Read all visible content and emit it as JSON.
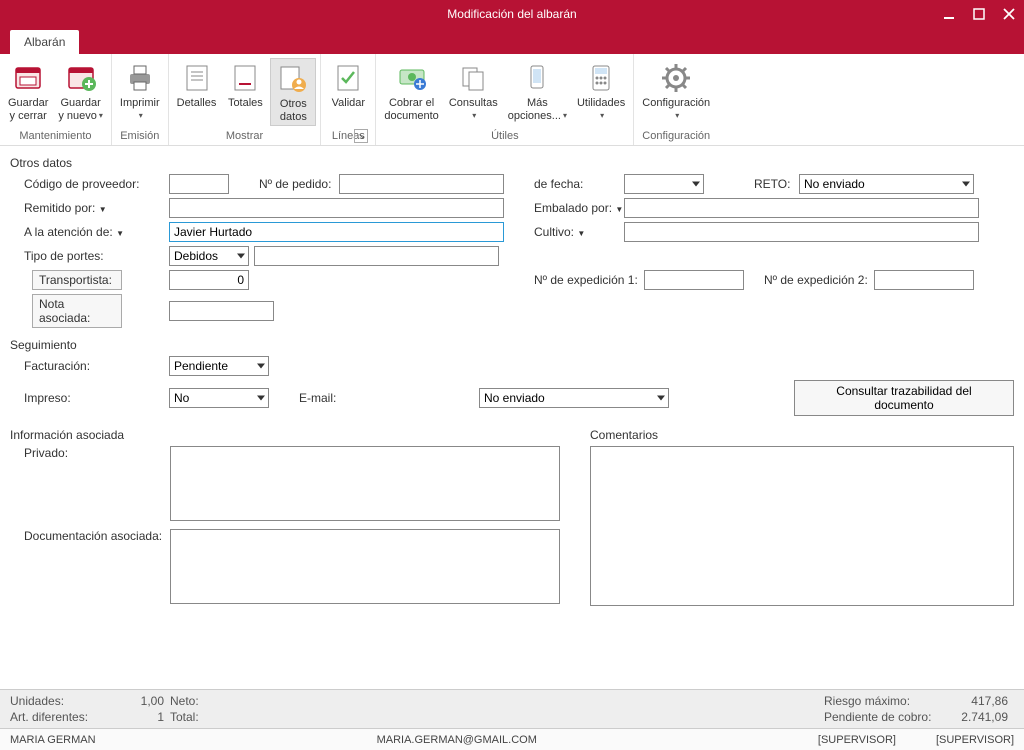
{
  "window": {
    "title": "Modificación del albarán"
  },
  "tabs": {
    "main": "Albarán"
  },
  "ribbon": {
    "mantenimiento": {
      "label": "Mantenimiento",
      "guardar_cerrar": "Guardar\ny cerrar",
      "guardar_nuevo": "Guardar\ny nuevo"
    },
    "emision": {
      "label": "Emisión",
      "imprimir": "Imprimir"
    },
    "mostrar": {
      "label": "Mostrar",
      "detalles": "Detalles",
      "totales": "Totales",
      "otros": "Otros\ndatos"
    },
    "lineas": {
      "label": "Líneas",
      "validar": "Validar"
    },
    "utiles": {
      "label": "Útiles",
      "cobrar": "Cobrar el\ndocumento",
      "consultas": "Consultas",
      "mas": "Más\nopciones...",
      "utilidades": "Utilidades"
    },
    "config": {
      "label": "Configuración",
      "config": "Configuración"
    }
  },
  "sections": {
    "otros_datos": "Otros datos",
    "seguimiento": "Seguimiento",
    "info": "Información asociada",
    "comentarios": "Comentarios"
  },
  "fields": {
    "codigo_proveedor": "Código de proveedor:",
    "n_pedido": "Nº de pedido:",
    "de_fecha": "de fecha:",
    "reto": "RETO:",
    "reto_value": "No enviado",
    "remitido_por": "Remitido por:",
    "embalado_por": "Embalado por:",
    "atencion": "A la atención de:",
    "atencion_value": "Javier Hurtado",
    "cultivo": "Cultivo:",
    "tipo_portes": "Tipo de portes:",
    "tipo_portes_value": "Debidos",
    "transportista": "Transportista:",
    "transportista_value": "0",
    "nota_asociada": "Nota asociada:",
    "n_exp_1": "Nº de expedición 1:",
    "n_exp_2": "Nº de expedición 2:",
    "facturacion": "Facturación:",
    "facturacion_value": "Pendiente",
    "impreso": "Impreso:",
    "impreso_value": "No",
    "email": "E-mail:",
    "email_value": "No enviado",
    "consultar_btn": "Consultar trazabilidad del documento",
    "privado": "Privado:",
    "documentacion": "Documentación asociada:"
  },
  "summary": {
    "unidades_lbl": "Unidades:",
    "unidades_val": "1,00",
    "neto_lbl": "Neto:",
    "art_lbl": "Art. diferentes:",
    "art_val": "1",
    "total_lbl": "Total:",
    "riesgo_lbl": "Riesgo máximo:",
    "riesgo_val": "417,86",
    "pendiente_lbl": "Pendiente de cobro:",
    "pendiente_val": "2.741,09"
  },
  "statusbar": {
    "user": "MARIA GERMAN",
    "email": "MARIA.GERMAN@GMAIL.COM",
    "role1": "[SUPERVISOR]",
    "role2": "[SUPERVISOR]"
  }
}
